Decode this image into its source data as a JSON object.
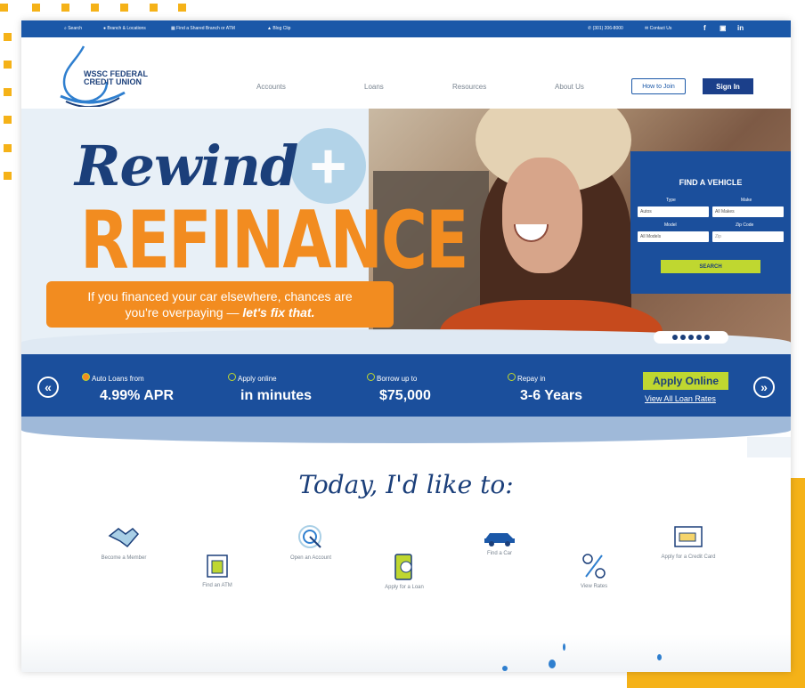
{
  "topbar": {
    "search": "Search",
    "branch": "Branch & Locations",
    "atm": "Find a Shared Branch or ATM",
    "blog": "Blog Clip",
    "phone": "(301) 206-8000",
    "contact": "Contact Us",
    "social": [
      "f",
      "▣",
      "in"
    ]
  },
  "logo": {
    "line1": "WSSC FEDERAL",
    "line2": "CREDIT UNION"
  },
  "nav": {
    "items": [
      "Accounts",
      "Loans",
      "Resources",
      "About Us"
    ],
    "join": "How to Join",
    "signin": "Sign In"
  },
  "hero": {
    "title1": "Rewind",
    "plus": "+",
    "title2": "REFINANCE",
    "banner_line1": "If you financed your car elsewhere, chances are",
    "banner_line2": "you're overpaying —",
    "banner_bold": "let's fix that."
  },
  "finder": {
    "title": "FIND A VEHICLE",
    "type_label": "Type",
    "make_label": "Make",
    "model_label": "Model",
    "zip_label": "Zip Code",
    "type_value": "Autos",
    "make_value": "All Makes",
    "model_value": "All Models",
    "zip_placeholder": "Zip",
    "search": "SEARCH"
  },
  "stats": {
    "items": [
      {
        "label": "Auto Loans from",
        "value": "4.99% APR"
      },
      {
        "label": "Apply online",
        "value": "in minutes"
      },
      {
        "label": "Borrow up to",
        "value": "$75,000"
      },
      {
        "label": "Repay in",
        "value": "3-6 Years"
      }
    ],
    "apply": "Apply Online",
    "rates": "View All Loan Rates",
    "prev": "«",
    "next": "»"
  },
  "today": {
    "title": "Today, I'd like to:"
  },
  "actions": [
    {
      "label": "Become a Member",
      "icon": "handshake-icon"
    },
    {
      "label": "Find an ATM",
      "icon": "atm-icon"
    },
    {
      "label": "Open an Account",
      "icon": "target-click-icon"
    },
    {
      "label": "Apply for a Loan",
      "icon": "phone-dollar-icon"
    },
    {
      "label": "Find a Car",
      "icon": "car-icon"
    },
    {
      "label": "View Rates",
      "icon": "percent-icon"
    },
    {
      "label": "Apply for a Credit Card",
      "icon": "credit-card-icon"
    }
  ],
  "colors": {
    "primary": "#1b58a8",
    "navy": "#1b3f7a",
    "orange": "#f28c20",
    "lime": "#bfd730",
    "frame": "#f5b218"
  }
}
